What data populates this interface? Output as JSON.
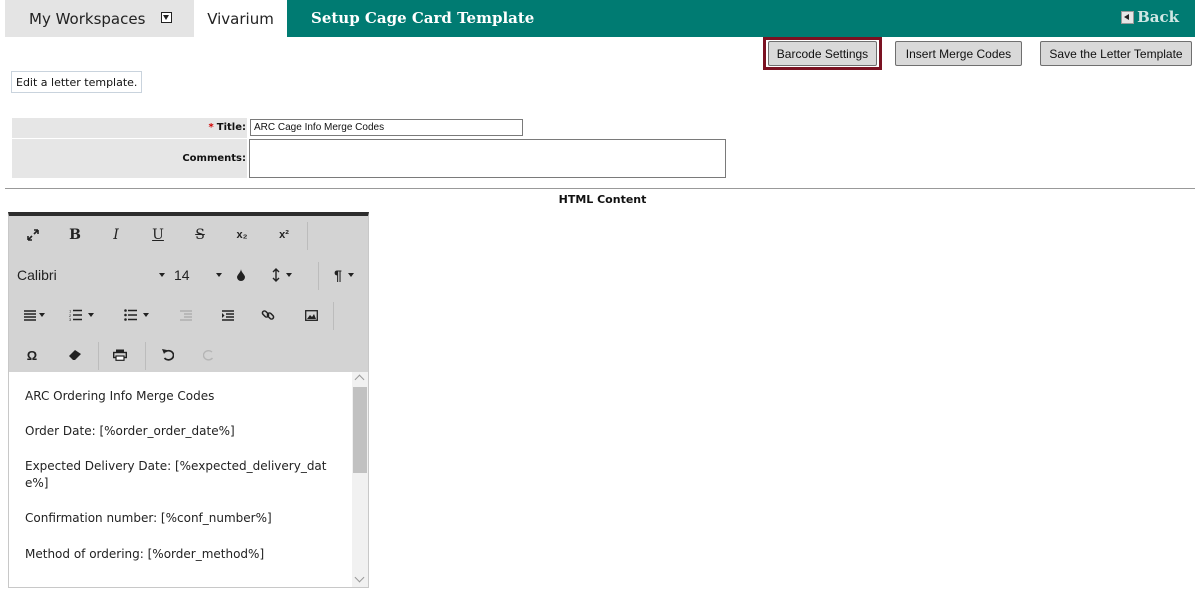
{
  "nav": {
    "workspaces_label": "My Workspaces",
    "vivarium_tab": "Vivarium",
    "page_title": "Setup Cage Card Template",
    "back_label": "Back"
  },
  "actions": {
    "barcode_settings": "Barcode Settings",
    "insert_merge_codes": "Insert Merge Codes",
    "save_template": "Save the Letter Template"
  },
  "hint": "Edit a letter template.",
  "form": {
    "title_label": "Title:",
    "required_mark": "*",
    "title_value": "ARC Cage Info Merge Codes",
    "comments_label": "Comments:",
    "comments_value": ""
  },
  "section_title": "HTML Content",
  "editor": {
    "toolbar": {
      "bold": "B",
      "italic": "I",
      "underline": "U",
      "strike": "S",
      "subscript": "x₂",
      "superscript": "x²",
      "font_family": "Calibri",
      "font_size": "14"
    },
    "paragraphs": [
      "ARC Ordering Info Merge Codes",
      "Order Date: [%order_order_date%]",
      "Expected  Delivery  Date:  [%expected_delivery_dat e%]",
      "Confirmation number: [%conf_number%]",
      "Method of ordering: [%order_method%]"
    ]
  },
  "colors": {
    "header_teal": "#007b72",
    "highlight_border": "#7b1222",
    "toolbar_bg": "#d3d3d3"
  }
}
